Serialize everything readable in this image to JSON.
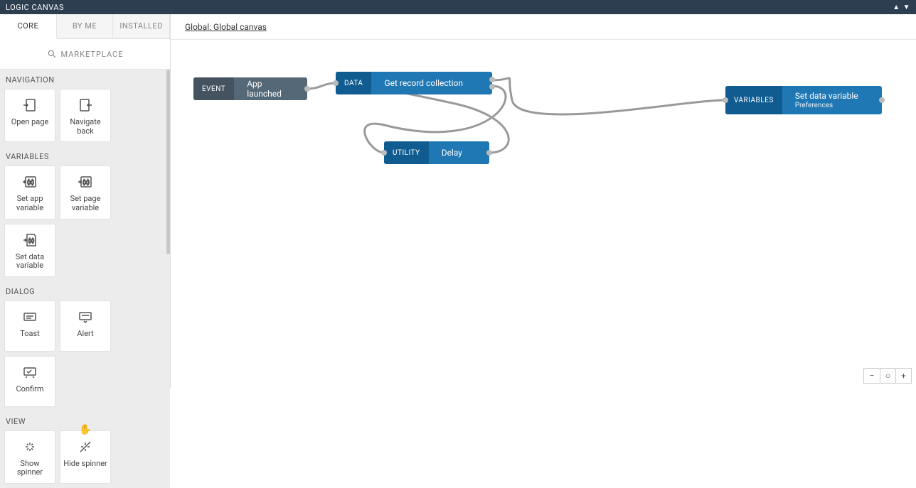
{
  "topbar": {
    "title": "LOGIC CANVAS"
  },
  "tabs": {
    "core": "CORE",
    "byme": "BY ME",
    "installed": "INSTALLED"
  },
  "marketplace": "MARKETPLACE",
  "sections": {
    "navigation": {
      "title": "NAVIGATION",
      "items": [
        {
          "label": "Open page"
        },
        {
          "label": "Navigate back"
        }
      ]
    },
    "variables": {
      "title": "VARIABLES",
      "items": [
        {
          "label": "Set app variable"
        },
        {
          "label": "Set page variable"
        },
        {
          "label": "Set data variable"
        }
      ]
    },
    "dialog": {
      "title": "DIALOG",
      "items": [
        {
          "label": "Toast"
        },
        {
          "label": "Alert"
        },
        {
          "label": "Confirm"
        }
      ]
    },
    "view": {
      "title": "VIEW",
      "items": [
        {
          "label": "Show spinner"
        },
        {
          "label": "Hide spinner"
        }
      ]
    }
  },
  "breadcrumb": "Global: Global canvas",
  "nodes": {
    "event": {
      "tag": "EVENT",
      "label": "App launched"
    },
    "data": {
      "tag": "DATA",
      "label": "Get record collection"
    },
    "utility": {
      "tag": "UTILITY",
      "label": "Delay"
    },
    "variables": {
      "tag": "VARIABLES",
      "label": "Set data variable",
      "sub": "Preferences"
    }
  },
  "zoom": {
    "out": "−",
    "reset": "○",
    "in": "+"
  }
}
